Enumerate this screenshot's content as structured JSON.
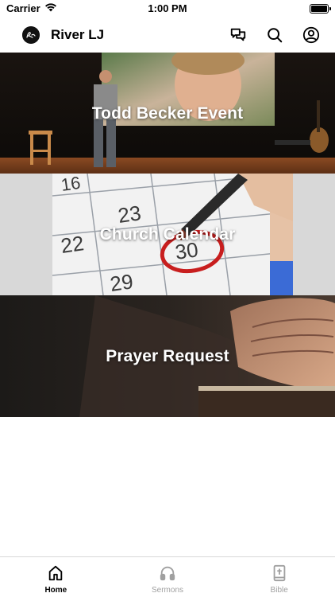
{
  "status_bar": {
    "carrier": "Carrier",
    "time": "1:00 PM",
    "battery_level": 1.0
  },
  "nav": {
    "title": "River LJ",
    "logo_text": "River",
    "icons": [
      "chat-icon",
      "search-icon",
      "account-icon"
    ]
  },
  "banners": [
    {
      "label": "Todd Becker Event"
    },
    {
      "label": "Church Calendar"
    },
    {
      "label": "Prayer Request"
    }
  ],
  "tabs": [
    {
      "label": "Home",
      "icon": "home-icon",
      "active": true
    },
    {
      "label": "Sermons",
      "icon": "headphones-icon",
      "active": false
    },
    {
      "label": "Bible",
      "icon": "bible-icon",
      "active": false
    }
  ],
  "colors": {
    "accent": "#000000",
    "inactive": "#a0a0a0"
  }
}
